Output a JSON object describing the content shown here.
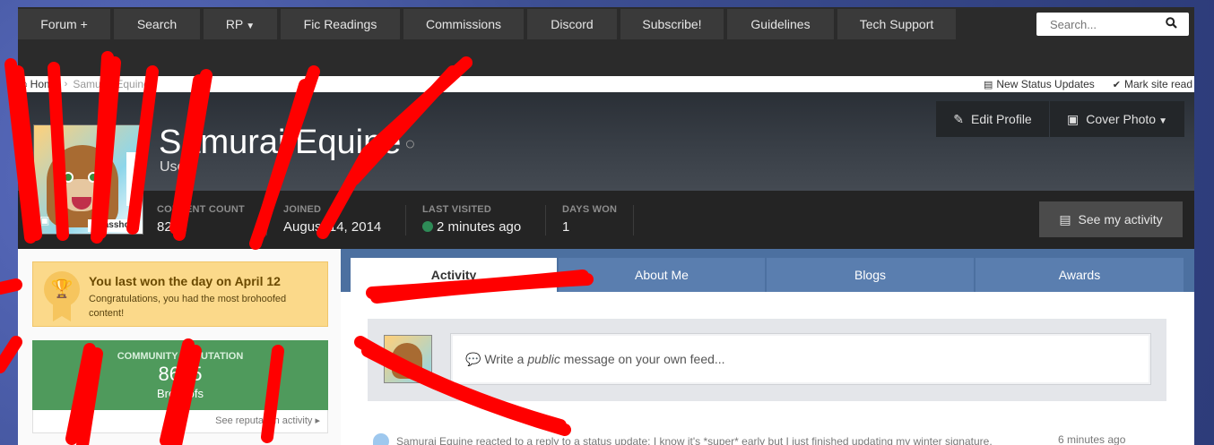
{
  "nav": {
    "items": [
      {
        "label": "Forum +",
        "caret": false
      },
      {
        "label": "Search",
        "caret": false
      },
      {
        "label": "RP",
        "caret": true
      },
      {
        "label": "Fic Readings",
        "caret": false
      },
      {
        "label": "Commissions",
        "caret": false
      },
      {
        "label": "Discord",
        "caret": false
      },
      {
        "label": "Subscribe!",
        "caret": false
      },
      {
        "label": "Guidelines",
        "caret": false
      },
      {
        "label": "Tech Support",
        "caret": false
      }
    ],
    "search_placeholder": "Search..."
  },
  "breadcrumb": {
    "home": "Home",
    "current": "Samurai Equine",
    "new_status": "New Status Updates",
    "mark_read": "Mark site read"
  },
  "profile": {
    "name": "Samurai Equine",
    "group": "Users",
    "avatar_tag": "Wasshoi",
    "edit_label": "Edit Profile",
    "cover_label": "Cover Photo"
  },
  "stats": {
    "content_count_label": "CONTENT COUNT",
    "content_count_value": "8271",
    "joined_label": "JOINED",
    "joined_value": "August 14, 2014",
    "last_visited_label": "LAST VISITED",
    "last_visited_value": "2 minutes ago",
    "days_won_label": "DAYS WON",
    "days_won_value": "1",
    "activity_label": "See my activity"
  },
  "sidebar": {
    "won_title": "You last won the day on April 12",
    "won_text": "Congratulations, you had the most brohoofed content!",
    "rep_label": "COMMUNITY REPUTATION",
    "rep_value": "8625",
    "rep_unit": "Brohoofs",
    "rep_link": "See reputation activity"
  },
  "tabs": [
    "Activity",
    "About Me",
    "Blogs",
    "Awards"
  ],
  "composer": {
    "prefix": "Write a ",
    "emphasis": "public",
    "suffix": " message on your own feed..."
  },
  "feed": {
    "text": "Samurai Equine reacted to a reply to a status update: I know it's *super* early but I just finished updating my winter signature.",
    "time": "6 minutes ago"
  },
  "colors": {
    "nav_bg": "#2b2b2b",
    "tab_strip": "#4c70a0",
    "reputation": "#4f9a5c",
    "won_day": "#fbd98a",
    "online": "#2e8b57",
    "scribble": "#ff0000"
  }
}
